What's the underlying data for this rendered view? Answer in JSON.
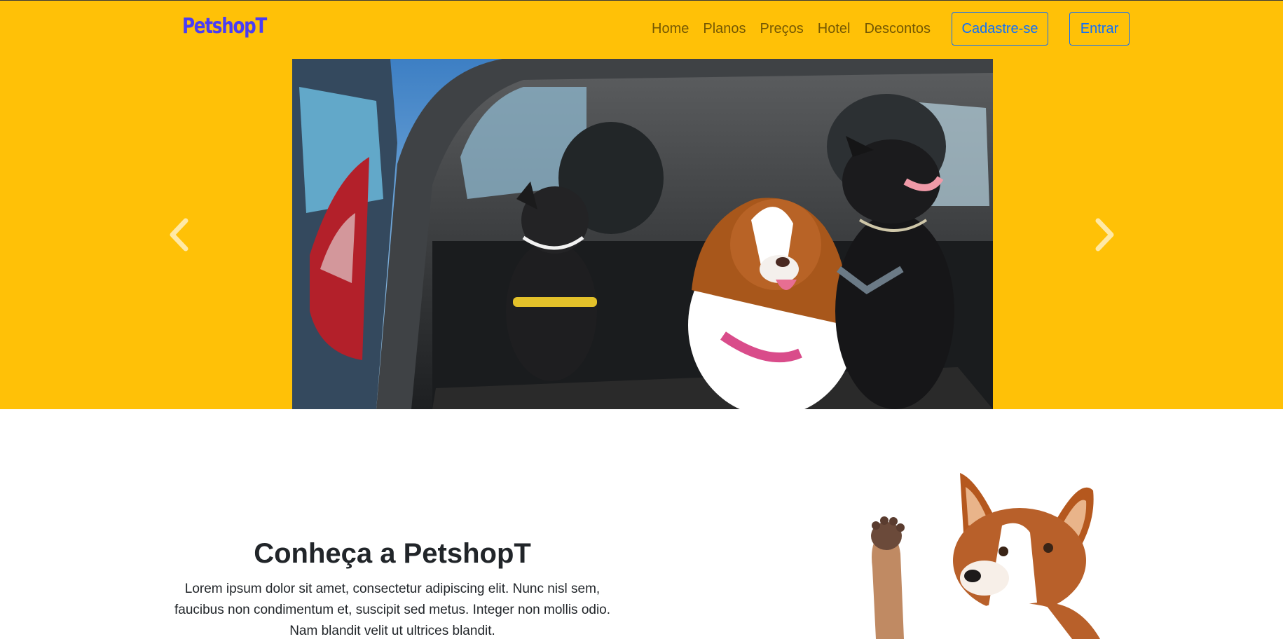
{
  "brand": "PetshopT",
  "nav": {
    "items": [
      {
        "label": "Home"
      },
      {
        "label": "Planos"
      },
      {
        "label": "Preços"
      },
      {
        "label": "Hotel"
      },
      {
        "label": "Descontos"
      }
    ],
    "signup_label": "Cadastre-se",
    "login_label": "Entrar"
  },
  "carousel": {
    "image": "dogs-in-car-trunk-photo",
    "prev_icon": "chevron-left-icon",
    "next_icon": "chevron-right-icon"
  },
  "about": {
    "title": "Conheça a PetshopT",
    "text": "Lorem ipsum dolor sit amet, consectetur adipiscing elit. Nunc nisl sem, faucibus non condimentum et, suscipit sed metus. Integer non mollis odio. Nam blandit velit ut ultrices blandit.",
    "image": "waving-dog-photo"
  },
  "colors": {
    "hero_bg": "#ffc107",
    "brand": "#4a3df5",
    "button_outline": "#0d6efd"
  }
}
